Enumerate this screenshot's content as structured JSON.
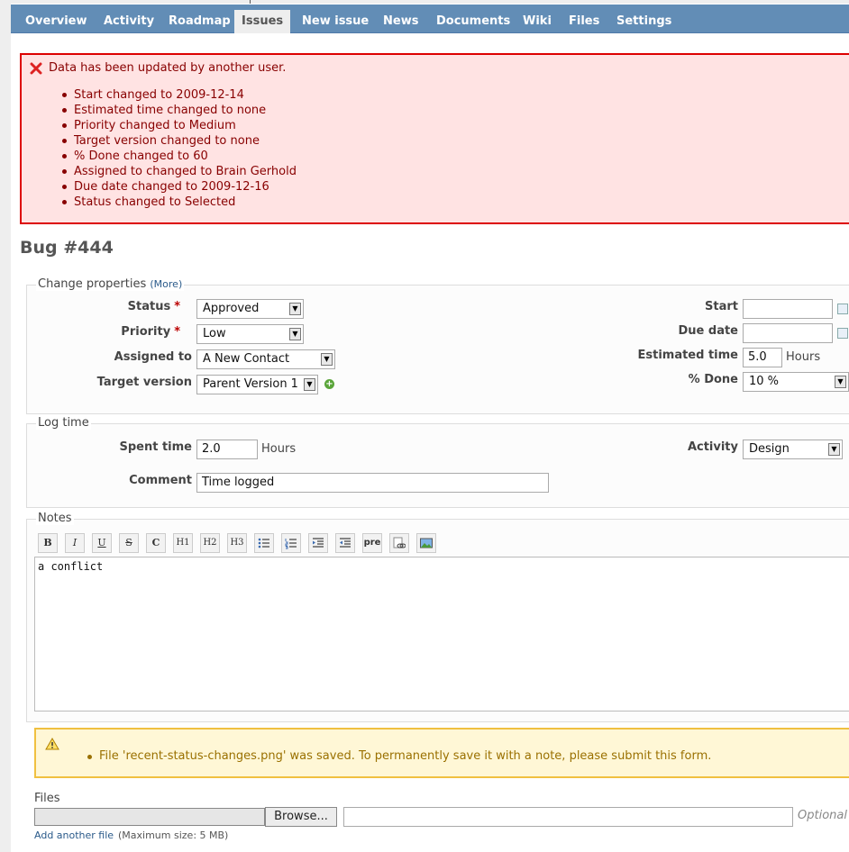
{
  "tabs": [
    {
      "label": "Overview"
    },
    {
      "label": "Activity"
    },
    {
      "label": "Roadmap"
    },
    {
      "label": "Issues"
    },
    {
      "label": "New issue"
    },
    {
      "label": "News"
    },
    {
      "label": "Documents"
    },
    {
      "label": "Wiki"
    },
    {
      "label": "Files"
    },
    {
      "label": "Settings"
    }
  ],
  "error": {
    "title": "Data has been updated by another user.",
    "changes": [
      "Start changed to 2009-12-14",
      "Estimated time changed to none",
      "Priority changed to Medium",
      "Target version changed to none",
      "% Done changed to 60",
      "Assigned to changed to Brain Gerhold",
      "Due date changed to 2009-12-16",
      "Status changed to Selected"
    ]
  },
  "issue": {
    "title": "Bug #444"
  },
  "properties": {
    "legend": "Change properties",
    "more_link": "(More)",
    "status": {
      "label": "Status",
      "required": "*",
      "value": "Approved"
    },
    "priority": {
      "label": "Priority",
      "required": "*",
      "value": "Low"
    },
    "assigned_to": {
      "label": "Assigned to",
      "value": "A New Contact"
    },
    "target_version": {
      "label": "Target version",
      "value": "Parent Version 1"
    },
    "start": {
      "label": "Start",
      "value": ""
    },
    "due_date": {
      "label": "Due date",
      "value": ""
    },
    "estimated_time": {
      "label": "Estimated time",
      "value": "5.0",
      "unit": "Hours"
    },
    "done": {
      "label": "% Done",
      "value": "10 %"
    }
  },
  "log_time": {
    "legend": "Log time",
    "spent_time": {
      "label": "Spent time",
      "value": "2.0",
      "unit": "Hours"
    },
    "activity": {
      "label": "Activity",
      "value": "Design"
    },
    "comment": {
      "label": "Comment",
      "value": "Time logged"
    }
  },
  "notes": {
    "legend": "Notes",
    "toolbar": [
      "B",
      "I",
      "U",
      "S",
      "C",
      "H1",
      "H2",
      "H3",
      "",
      "",
      "",
      "",
      "pre",
      "",
      ""
    ],
    "text": "a conflict"
  },
  "warning": {
    "message": "File 'recent-status-changes.png' was saved. To permanently save it with a note, please submit this form."
  },
  "files": {
    "label": "Files",
    "browse_label": "Browse...",
    "optional_text": "Optional d",
    "add_another": "Add another file",
    "max_size": "(Maximum size: 5 MB)"
  },
  "colors": {
    "tab_bar": "#628db6",
    "error_bg": "#ffe3e3",
    "error_border": "#dd0000",
    "warning_bg": "#fff7d6",
    "warning_border": "#f0c040"
  }
}
